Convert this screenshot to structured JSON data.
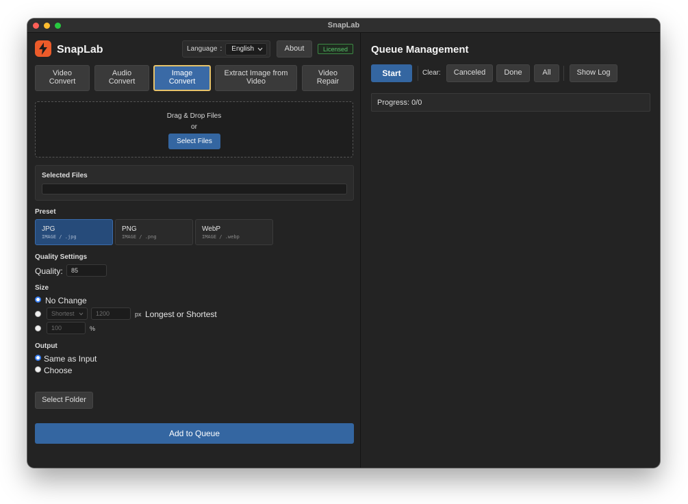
{
  "window": {
    "title": "SnapLab"
  },
  "header": {
    "app_name": "SnapLab",
    "language_label": "Language",
    "language_sep": ":",
    "language_value": "English",
    "about_label": "About",
    "license_badge": "Licensed"
  },
  "tabs": [
    {
      "line1": "Video",
      "line2": "Convert"
    },
    {
      "line1": "Audio",
      "line2": "Convert"
    },
    {
      "line1": "Image",
      "line2": "Convert"
    },
    {
      "line1": "Extract Image from",
      "line2": "Video"
    },
    {
      "line1": "Video",
      "line2": "Repair"
    }
  ],
  "active_tab": "Image Convert",
  "dropzone": {
    "line1": "Drag & Drop Files",
    "line2": "or",
    "button": "Select Files"
  },
  "selected_files": {
    "title": "Selected Files"
  },
  "preset": {
    "title": "Preset",
    "items": [
      {
        "name": "JPG",
        "sub": "IMAGE / .jpg"
      },
      {
        "name": "PNG",
        "sub": "IMAGE / .png"
      },
      {
        "name": "WebP",
        "sub": "IMAGE / .webp"
      }
    ],
    "selected": "JPG"
  },
  "quality": {
    "title": "Quality Settings",
    "label": "Quality:",
    "value": "85"
  },
  "size": {
    "title": "Size",
    "option_no_change": "No Change",
    "mode_value": "Shortest",
    "px_value": "1200",
    "px_unit": "px",
    "longest_label": "Longest or Shortest",
    "percent_value": "100",
    "percent_unit": "%",
    "selected": "No Change"
  },
  "output": {
    "title": "Output",
    "option_same": "Same as Input",
    "option_choose": "Choose",
    "select_folder": "Select Folder",
    "selected": "Same as Input"
  },
  "add_queue": "Add to Queue",
  "queue": {
    "title": "Queue Management",
    "start": "Start",
    "clear_label": "Clear:",
    "canceled": "Canceled",
    "done": "Done",
    "all": "All",
    "show_log": "Show Log",
    "progress": "Progress: 0/0"
  },
  "colors": {
    "accent_blue": "#3466a1",
    "active_tab_border": "#e7c36b",
    "logo_orange": "#ec5b2a",
    "licensed_green": "#58c26a",
    "window_bg": "#232323"
  },
  "icons": {
    "logo": "lightning-bolt-icon",
    "dropdown": "chevron-down-icon"
  }
}
